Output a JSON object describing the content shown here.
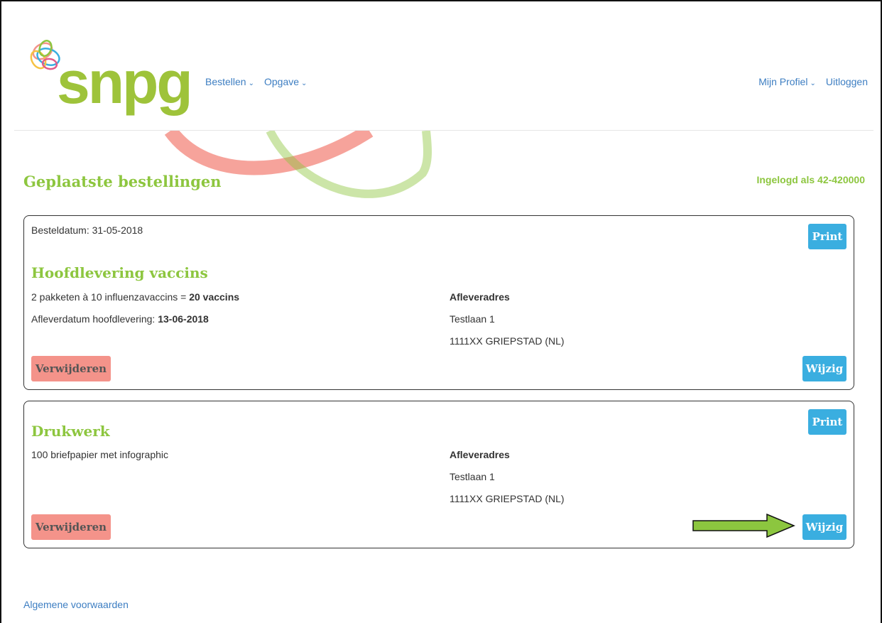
{
  "header": {
    "logo_text": "snpg",
    "nav_left": [
      {
        "label": "Bestellen"
      },
      {
        "label": "Opgave"
      }
    ],
    "nav_right": {
      "profile_label": "Mijn Profiel",
      "logout_label": "Uitloggen"
    }
  },
  "page": {
    "title": "Geplaatste bestellingen",
    "logged_in": "Ingelogd als 42-420000"
  },
  "orders": [
    {
      "order_date": "Besteldatum: 31-05-2018",
      "title": "Hoofdlevering vaccins",
      "line1_prefix": "2 pakketen à 10 influenzavaccins = ",
      "line1_bold": "20 vaccins",
      "line2_prefix": "Afleverdatum hoofdlevering: ",
      "line2_bold": "13-06-2018",
      "address_heading": "Afleveradres",
      "address_street": "Testlaan 1",
      "address_city": "1111XX GRIEPSTAD (NL)",
      "print_label": "Print",
      "edit_label": "Wijzig",
      "delete_label": "Verwijderen"
    },
    {
      "title": "Drukwerk",
      "line1": "100 briefpapier met infographic",
      "address_heading": "Afleveradres",
      "address_street": "Testlaan 1",
      "address_city": "1111XX GRIEPSTAD (NL)",
      "print_label": "Print",
      "edit_label": "Wijzig",
      "delete_label": "Verwijderen"
    }
  ],
  "footer": {
    "terms_label": "Algemene voorwaarden"
  },
  "colors": {
    "brand_green": "#8dc63f",
    "link_blue": "#3d7ec2",
    "button_blue": "#3aaee0",
    "delete_red": "#f4938a",
    "arrow_green": "#8cc63f"
  },
  "icons": {
    "chevron": "chevron-down-icon",
    "arrow": "arrow-right-icon",
    "logo": "snpg-logo-icon"
  }
}
